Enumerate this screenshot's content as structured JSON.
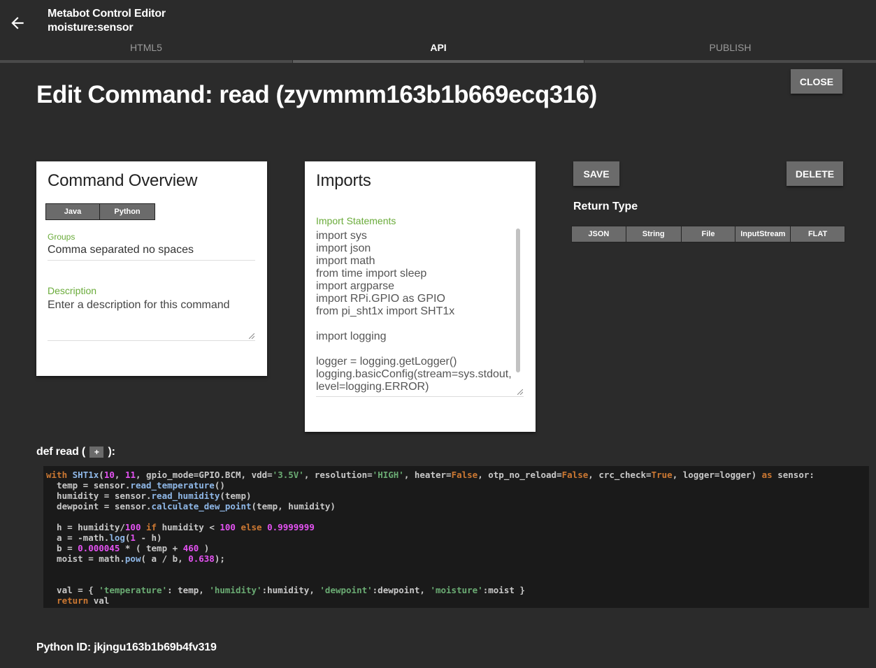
{
  "header": {
    "title": "Metabot Control Editor",
    "subtitle": "moisture:sensor",
    "tabs": [
      {
        "label": "HTML5",
        "active": false
      },
      {
        "label": "API",
        "active": true
      },
      {
        "label": "PUBLISH",
        "active": false
      }
    ]
  },
  "page": {
    "title": "Edit Command: read (zyvmmm163b1b669ecq316)",
    "close_label": "CLOSE",
    "save_label": "SAVE",
    "delete_label": "DELETE"
  },
  "overview": {
    "title": "Command Overview",
    "lang_options": [
      "Java",
      "Python"
    ],
    "groups_label": "Groups",
    "groups_value": "Comma separated no spaces",
    "description_label": "Description",
    "description_placeholder": "Enter a description for this command"
  },
  "imports": {
    "title": "Imports",
    "label": "Import Statements",
    "lines": [
      "import sys",
      "import json",
      "import math",
      "from time import sleep",
      "import argparse",
      "import RPi.GPIO as GPIO",
      "from pi_sht1x import SHT1x",
      "",
      "import logging",
      "",
      "logger = logging.getLogger()",
      "logging.basicConfig(stream=sys.stdout,",
      "level=logging.ERROR)"
    ]
  },
  "return_type": {
    "label": "Return Type",
    "options": [
      "JSON",
      "String",
      "File",
      "InputStream",
      "FLAT"
    ]
  },
  "function": {
    "def_prefix": "def read (",
    "add_label": "+",
    "def_suffix": "):"
  },
  "code": {
    "lines": [
      "with SHT1x(10, 11, gpio_mode=GPIO.BCM, vdd='3.5V', resolution='HIGH', heater=False, otp_no_reload=False, crc_check=True, logger=logger) as sensor:",
      "  temp = sensor.read_temperature()",
      "  humidity = sensor.read_humidity(temp)",
      "  dewpoint = sensor.calculate_dew_point(temp, humidity)",
      "",
      "  h = humidity/100 if humidity < 100 else 0.9999999",
      "  a = -math.log(1 - h)",
      "  b = 0.000045 * ( temp + 460 )",
      "  moist = math.pow( a / b, 0.638);",
      "",
      "",
      "  val = { 'temperature': temp, 'humidity':humidity, 'dewpoint':dewpoint, 'moisture':moist }",
      "  return val"
    ]
  },
  "footer": {
    "python_id": "Python ID: jkjngu163b1b69b4fv319"
  }
}
